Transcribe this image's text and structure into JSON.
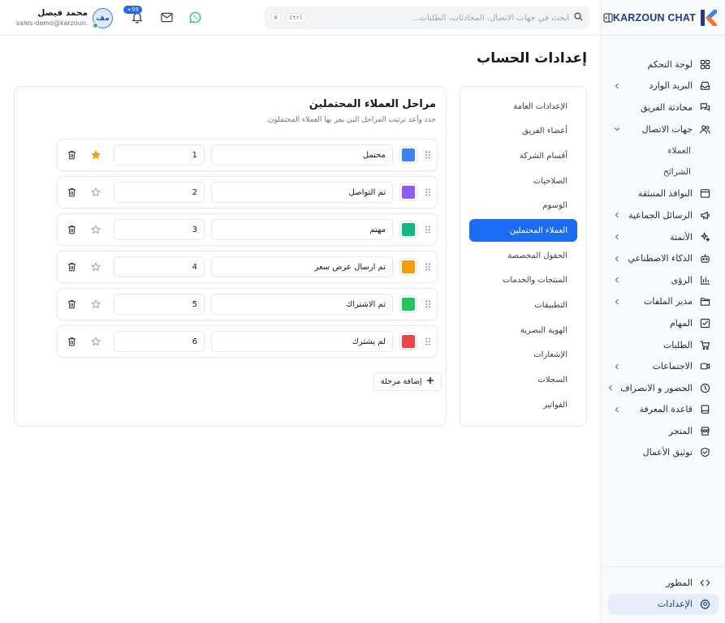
{
  "brand": {
    "name": "KARZOUN CHAT"
  },
  "sidebar": {
    "items": [
      {
        "label": "لوحة التحكم",
        "icon": "grid-icon",
        "chevron": false
      },
      {
        "label": "البريد الوارد",
        "icon": "inbox-icon",
        "chevron": true
      },
      {
        "label": "محادثة الفريق",
        "icon": "chat-icon",
        "chevron": false
      },
      {
        "label": "جهات الاتصال",
        "icon": "users-icon",
        "chevron": true,
        "expanded": true,
        "children": [
          "العملاء",
          "الشرائح"
        ]
      },
      {
        "label": "النوافذ المنبثقة",
        "icon": "window-icon",
        "chevron": false
      },
      {
        "label": "الرسائل الجماعية",
        "icon": "megaphone-icon",
        "chevron": true
      },
      {
        "label": "الأتمتة",
        "icon": "sparkles-icon",
        "chevron": true
      },
      {
        "label": "الذكاء الاصطناعي",
        "icon": "bot-icon",
        "chevron": true
      },
      {
        "label": "الرؤى",
        "icon": "chart-icon",
        "chevron": true
      },
      {
        "label": "مدير الملفات",
        "icon": "folder-icon",
        "chevron": true
      },
      {
        "label": "المهام",
        "icon": "checkbox-icon",
        "chevron": false
      },
      {
        "label": "الطلبات",
        "icon": "cart-icon",
        "chevron": false
      },
      {
        "label": "الاجتماعات",
        "icon": "video-icon",
        "chevron": true
      },
      {
        "label": "الحضور و الانصراف",
        "icon": "clock-icon",
        "chevron": true
      },
      {
        "label": "قاعدة المعرفة",
        "icon": "book-icon",
        "chevron": true
      },
      {
        "label": "المتجر",
        "icon": "store-icon",
        "chevron": false
      },
      {
        "label": "توثيق الأعمال",
        "icon": "shield-check-icon",
        "chevron": false
      }
    ],
    "footer": [
      {
        "label": "المطور",
        "icon": "code-icon"
      },
      {
        "label": "الإعدادات",
        "icon": "gear-icon",
        "active": true
      }
    ]
  },
  "header": {
    "search_placeholder": "ابحث في جهات الاتصال، المحادثات، الطلبات...",
    "shortcut_ctrl": "Ctrl",
    "shortcut_k": "K",
    "notifications_badge": "+99",
    "user": {
      "name": "محمد فيصل",
      "email": "sales-demo@karzoun...",
      "initials": "مف"
    }
  },
  "page": {
    "title": "إعدادات الحساب",
    "settings_menu": [
      "الإعدادات العامة",
      "أعضاء الفريق",
      "أقسام الشركة",
      "الصلاحيات",
      "الوسوم",
      "العملاء المحتملين",
      "الحقول المخصصة",
      "المنتجات والخدمات",
      "التطبيقات",
      "الهوية البصرية",
      "الإشعارات",
      "السجلات",
      "الفواتير"
    ],
    "active_menu_index": 5
  },
  "card": {
    "title": "مراحل العملاء المحتملين",
    "description": "حدد وأعد ترتيب المراحل التي يمر بها العملاء المحتملون.",
    "stages": [
      {
        "name": "محتمل",
        "order": "1",
        "color": "#3b82f6",
        "is_default": true
      },
      {
        "name": "تم التواصل",
        "order": "2",
        "color": "#8b5cf6",
        "is_default": false
      },
      {
        "name": "مهتم",
        "order": "3",
        "color": "#10b981",
        "is_default": false
      },
      {
        "name": "تم ارسال عرض سعر",
        "order": "4",
        "color": "#f59e0b",
        "is_default": false
      },
      {
        "name": "تم الاشتراك",
        "order": "5",
        "color": "#22c55e",
        "is_default": false
      },
      {
        "name": "لم يشترك",
        "order": "6",
        "color": "#ef4444",
        "is_default": false
      }
    ],
    "add_button": "إضافة مرحلة"
  },
  "colors": {
    "accent": "#1b6cf2",
    "star": "#f59e0b",
    "whatsapp": "#22c55e"
  }
}
